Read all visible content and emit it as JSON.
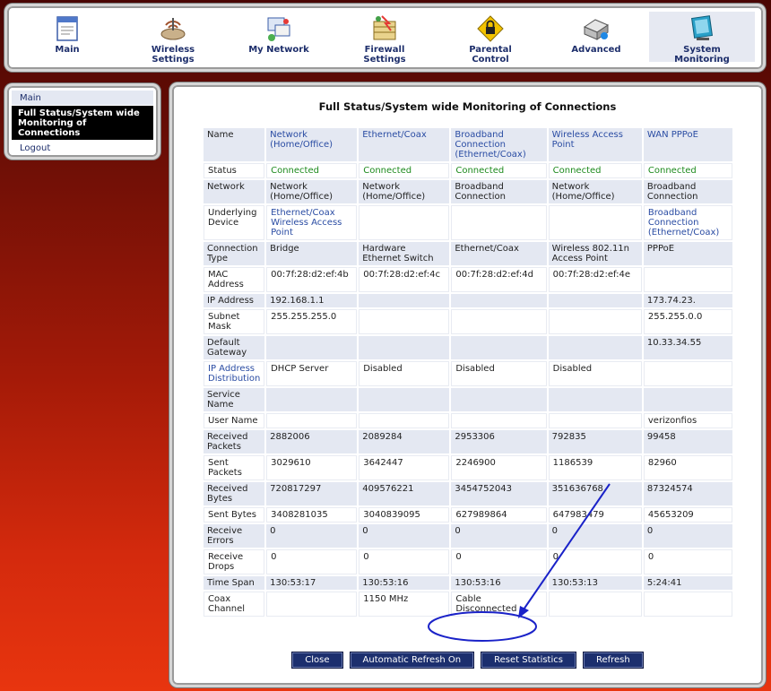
{
  "nav": {
    "items": [
      {
        "label": "Main",
        "icon": "main-page-icon"
      },
      {
        "label": "Wireless\nSettings",
        "icon": "wireless-router-icon"
      },
      {
        "label": "My Network",
        "icon": "network-computers-icon"
      },
      {
        "label": "Firewall\nSettings",
        "icon": "firewall-icon"
      },
      {
        "label": "Parental\nControl",
        "icon": "padlock-sign-icon"
      },
      {
        "label": "Advanced",
        "icon": "advanced-tools-icon"
      },
      {
        "label": "System\nMonitoring",
        "icon": "monitor-icon"
      }
    ],
    "active_index": 6
  },
  "sidebar": {
    "items": [
      {
        "label": "Main"
      },
      {
        "label": "Full Status/System wide Monitoring of Connections"
      },
      {
        "label": "Logout"
      }
    ],
    "active_index": 1
  },
  "page": {
    "title": "Full Status/System wide Monitoring of Connections"
  },
  "table": {
    "header": {
      "label": "Name",
      "cols": [
        "Network (Home/Office)",
        "Ethernet/Coax",
        "Broadband Connection (Ethernet/Coax)",
        "Wireless Access Point",
        "WAN PPPoE"
      ]
    },
    "rows": [
      {
        "label": "Status",
        "values": [
          "Connected",
          "Connected",
          "Connected",
          "Connected",
          "Connected"
        ]
      },
      {
        "label": "Network",
        "values": [
          "Network (Home/Office)",
          "Network (Home/Office)",
          "Broadband Connection",
          "Network (Home/Office)",
          "Broadband Connection"
        ]
      },
      {
        "label": "Underlying Device",
        "values": [
          "Ethernet/Coax Wireless Access Point",
          "",
          "",
          "",
          "Broadband Connection (Ethernet/Coax)"
        ]
      },
      {
        "label": "Connection Type",
        "values": [
          "Bridge",
          "Hardware Ethernet Switch",
          "Ethernet/Coax",
          "Wireless 802.11n Access Point",
          "PPPoE"
        ]
      },
      {
        "label": "MAC Address",
        "values": [
          "00:7f:28:d2:ef:4b",
          "00:7f:28:d2:ef:4c",
          "00:7f:28:d2:ef:4d",
          "00:7f:28:d2:ef:4e",
          ""
        ]
      },
      {
        "label": "IP Address",
        "values": [
          "192.168.1.1",
          "",
          "",
          "",
          "173.74.23."
        ]
      },
      {
        "label": "Subnet Mask",
        "values": [
          "255.255.255.0",
          "",
          "",
          "",
          "255.255.0.0"
        ]
      },
      {
        "label": "Default Gateway",
        "values": [
          "",
          "",
          "",
          "",
          "10.33.34.55"
        ]
      },
      {
        "label": "IP Address Distribution",
        "values": [
          "DHCP Server",
          "Disabled",
          "Disabled",
          "Disabled",
          ""
        ]
      },
      {
        "label": "Service Name",
        "values": [
          "",
          "",
          "",
          "",
          ""
        ]
      },
      {
        "label": "User Name",
        "values": [
          "",
          "",
          "",
          "",
          "verizonfios"
        ]
      },
      {
        "label": "Received Packets",
        "values": [
          "2882006",
          "2089284",
          "2953306",
          "792835",
          "99458"
        ]
      },
      {
        "label": "Sent Packets",
        "values": [
          "3029610",
          "3642447",
          "2246900",
          "1186539",
          "82960"
        ]
      },
      {
        "label": "Received Bytes",
        "values": [
          "720817297",
          "409576221",
          "3454752043",
          "351636768",
          "87324574"
        ]
      },
      {
        "label": "Sent Bytes",
        "values": [
          "3408281035",
          "3040839095",
          "627989864",
          "647983479",
          "45653209"
        ]
      },
      {
        "label": "Receive Errors",
        "values": [
          "0",
          "0",
          "0",
          "0",
          "0"
        ]
      },
      {
        "label": "Receive Drops",
        "values": [
          "0",
          "0",
          "0",
          "0",
          "0"
        ]
      },
      {
        "label": "Time Span",
        "values": [
          "130:53:17",
          "130:53:16",
          "130:53:16",
          "130:53:13",
          "5:24:41"
        ]
      },
      {
        "label": "Coax Channel",
        "values": [
          "",
          "1150 MHz",
          "Cable Disconnected",
          "",
          ""
        ]
      }
    ]
  },
  "buttons": {
    "close": "Close",
    "auto_refresh": "Automatic Refresh On",
    "reset_stats": "Reset Statistics",
    "refresh": "Refresh"
  },
  "colors": {
    "nav_text": "#1d2e6b",
    "link_text": "#2a4ca3",
    "connected": "#1d8a1d",
    "button_bg": "#1c2f6e",
    "annotation": "#1a22c8"
  }
}
